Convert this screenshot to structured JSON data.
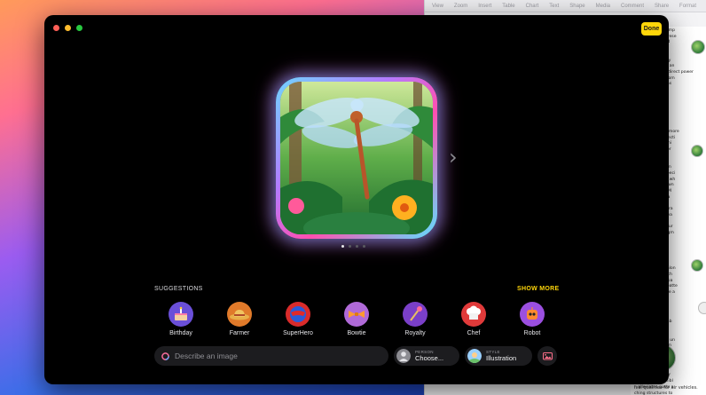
{
  "background_doc": {
    "toolbar": [
      "View",
      "Zoom",
      "Insert",
      "Table",
      "Chart",
      "Text",
      "Shape",
      "Media",
      "Comment",
      "Share",
      "Format"
    ],
    "lines": [
      "ng, dragonflies emp",
      ". In the face of prese",
      "urvival. Anchored",
      "tes and wings",
      "les per hour and",
      "les per hour. They",
      "ights per second an",
      "er second). This direct power",
      "ies dragonflies from",
      "her but without as",
      "st ratios.",
      "",
      "four styles",
      "aerial str",
      "aerodyn",
      "moving a",
      "efficient, high",
      "stroking to build more",
      "making rapid directi",
      "ust with synchroni",
      "re glide updraft or",
      "aking convective",
      "move quickly",
      "tion, especially on",
      "heating, some speci",
      "y provide shade, wh",
      "shade to cool down",
      "ater for cooling. M",
      "which looks like a",
      "As cold-blooded",
      "ht muscle tempera",
      "their wings to crea",
      "",
      "ysiological structur",
      "rized by pterostigm",
      "weight at the e",
      "veins along th",
      "help dragonfli",
      "air. These vein",
      "t functions like a",
      "e that's flexible alon",
      "d optimal biomech",
      "e \"golden ratio\" pa",
      "ed in the veins' patte",
      "gonfly wings have a",
      "their flexibility",
      "tantly allows for",
      "ced in wing",
      "ing with their",
      "ly wings are durab",
      "ormations.",
      "",
      "agonflies are the un",
      "interested in biom",
      "aerial",
      "stru",
      "creat",
      "bles",
      "e of each dragonf",
      "ke a tailored flexibl",
      "n alleviates gusts a",
      "ching structures to"
    ],
    "bottom_line": "ival qualities for air vehicles."
  },
  "window": {
    "done_label": "Done"
  },
  "pager": {
    "count": 4,
    "active": 0
  },
  "suggestions": {
    "title": "SUGGESTIONS",
    "show_more_label": "SHOW MORE",
    "items": [
      {
        "label": "Birthday",
        "icon": "birthday-cake-icon",
        "color": "#6a4fd8"
      },
      {
        "label": "Farmer",
        "icon": "straw-hat-icon",
        "color": "#e07a2a"
      },
      {
        "label": "SuperHero",
        "icon": "superhero-mask-icon",
        "color": "#d92b2b"
      },
      {
        "label": "Bowtie",
        "icon": "bowtie-icon",
        "color": "#b06ad8"
      },
      {
        "label": "Royalty",
        "icon": "scepter-icon",
        "color": "#7a3fc8"
      },
      {
        "label": "Chef",
        "icon": "chef-hat-icon",
        "color": "#e03a3a"
      },
      {
        "label": "Robot",
        "icon": "robot-icon",
        "color": "#9b4fe0"
      }
    ]
  },
  "prompt": {
    "placeholder": "Describe an image",
    "value": ""
  },
  "person_pill": {
    "caption": "PERSON",
    "value": "Choose..."
  },
  "style_pill": {
    "caption": "STYLE",
    "value": "Illustration"
  },
  "colors": {
    "accent": "#ffd60a",
    "panel": "#1c1c1f",
    "window_bg": "#000000"
  }
}
